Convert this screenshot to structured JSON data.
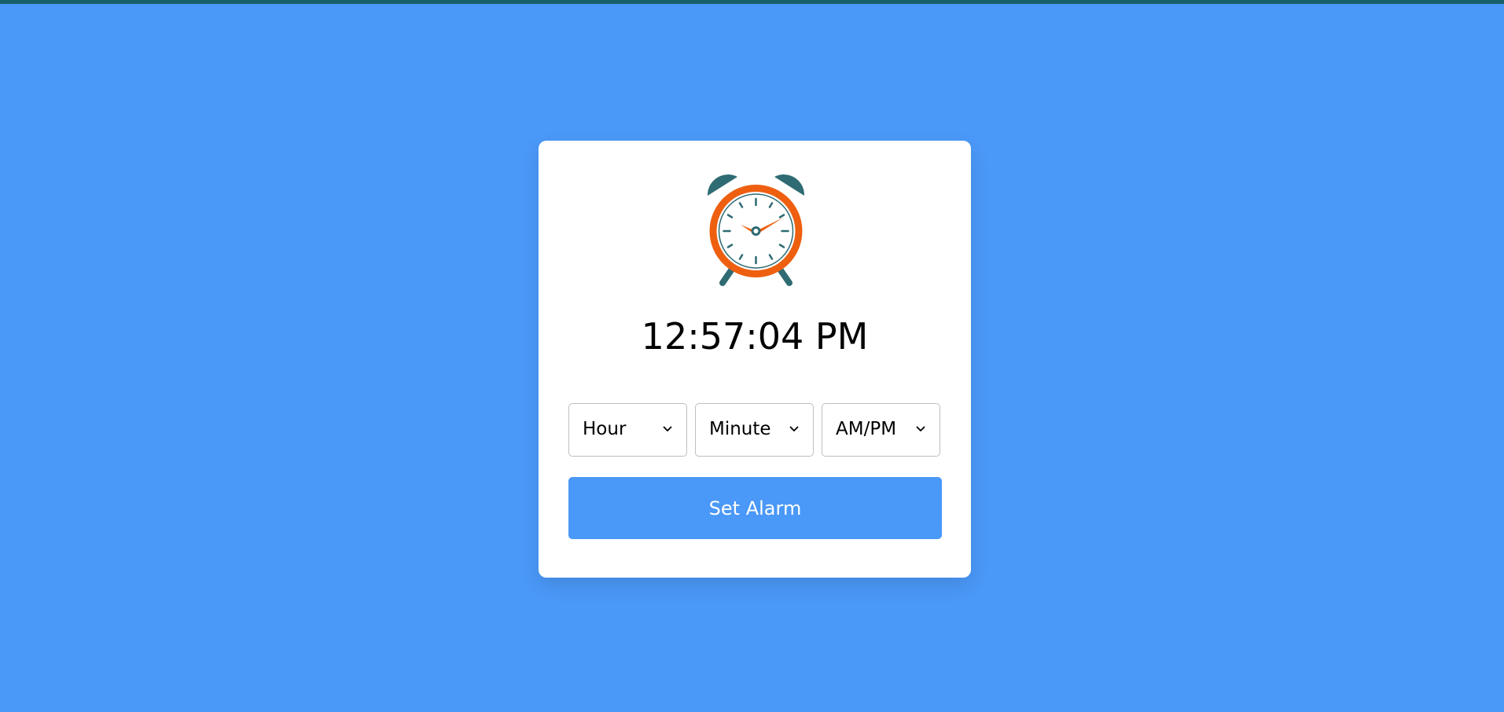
{
  "app": {
    "current_time": "12:57:04 PM"
  },
  "alarm_form": {
    "hour": {
      "selected": "Hour"
    },
    "minute": {
      "selected": "Minute"
    },
    "ampm": {
      "selected": "AM/PM"
    },
    "set_button_label": "Set Alarm"
  },
  "icons": {
    "clock": "alarm-clock-icon",
    "dropdown": "chevron-down-icon"
  },
  "colors": {
    "background": "#4a98f7",
    "top_bar": "#17606a",
    "card": "#ffffff",
    "button": "#4a98f7",
    "clock_ring": "#ee5f10",
    "clock_bells": "#2f6b73"
  }
}
